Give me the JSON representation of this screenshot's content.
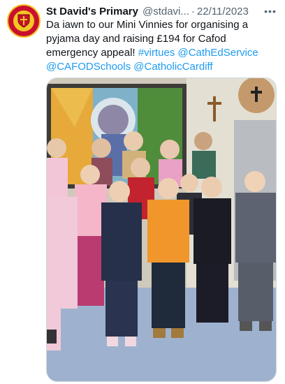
{
  "tweet": {
    "author_name": "St David's Primary",
    "author_handle": "@stdavi...",
    "separator": "·",
    "date": "22/11/2023",
    "more_icon": "more-horizontal-icon",
    "text_plain": "Da iawn to our Mini Vinnies for organising a pyjama day and raising £194 for Cafod emergency appeal!",
    "links": [
      "#virtues",
      "@CathEdService",
      "@CAFODSchools",
      "@CatholicCardiff"
    ]
  },
  "colors": {
    "link": "#1d9bf0",
    "secondary_text": "#536471",
    "avatar_red": "#c8102e",
    "avatar_gold": "#f3c623"
  }
}
